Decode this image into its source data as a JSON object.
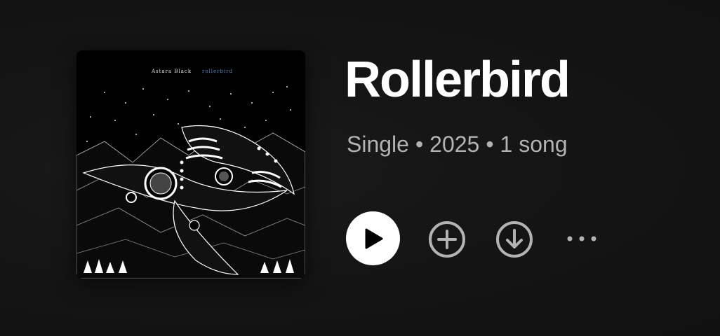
{
  "album": {
    "cover_artist_text": "Astara Black",
    "cover_album_text": "rollerbird",
    "title": "Rollerbird",
    "type": "Single",
    "year": "2025",
    "song_count": "1 song",
    "separator": "•"
  },
  "actions": {
    "play_icon": "play-icon",
    "add_icon": "plus-circle-icon",
    "download_icon": "download-circle-icon",
    "more_icon": "more-horizontal-icon"
  },
  "colors": {
    "background": "#121212",
    "title": "#ffffff",
    "meta": "#b3b3b3",
    "icon": "#b3b3b3",
    "play_button": "#ffffff"
  }
}
